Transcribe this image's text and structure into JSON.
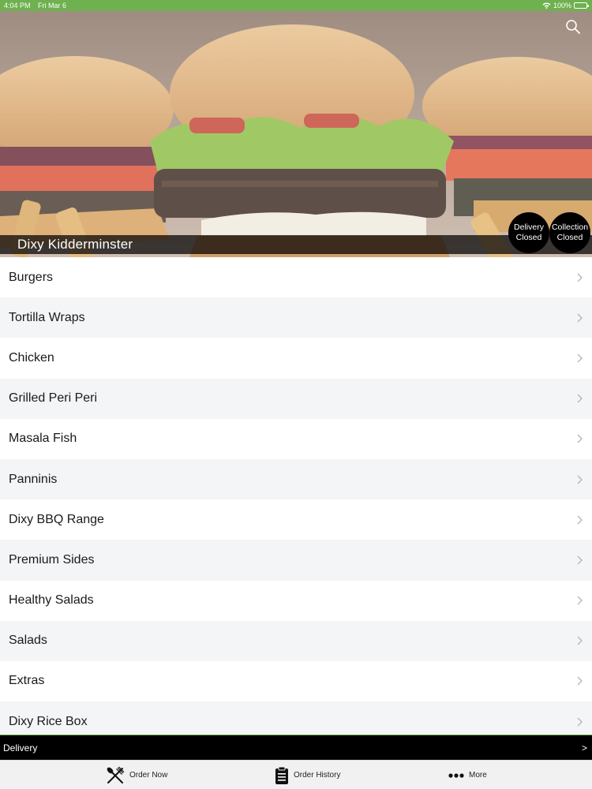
{
  "status_bar": {
    "time": "4:04 PM",
    "date": "Fri Mar 6",
    "battery": "100%"
  },
  "store": {
    "name": "Dixy Kidderminster",
    "delivery_badge": [
      "Delivery",
      "Closed"
    ],
    "collection_badge": [
      "Collection",
      "Closed"
    ]
  },
  "menu": {
    "categories": [
      "Burgers",
      "Tortilla Wraps",
      "Chicken",
      "Grilled Peri Peri",
      "Masala Fish",
      "Panninis",
      "Dixy BBQ Range",
      "Premium Sides",
      "Healthy Salads",
      "Salads",
      "Extras",
      "Dixy Rice Box"
    ]
  },
  "delivery_bar": {
    "label": "Delivery",
    "arrow": ">"
  },
  "tabs": {
    "order_now": "Order Now",
    "order_history": "Order History",
    "more": "More"
  },
  "colors": {
    "accent_green": "#6fb04f",
    "bar_black": "#000000",
    "row_alt": "#f3f5f6"
  },
  "icons": [
    "search-icon",
    "wifi-icon",
    "battery-icon",
    "chevron-right-icon",
    "fork-knife-icon",
    "clipboard-icon",
    "more-dots-icon"
  ]
}
